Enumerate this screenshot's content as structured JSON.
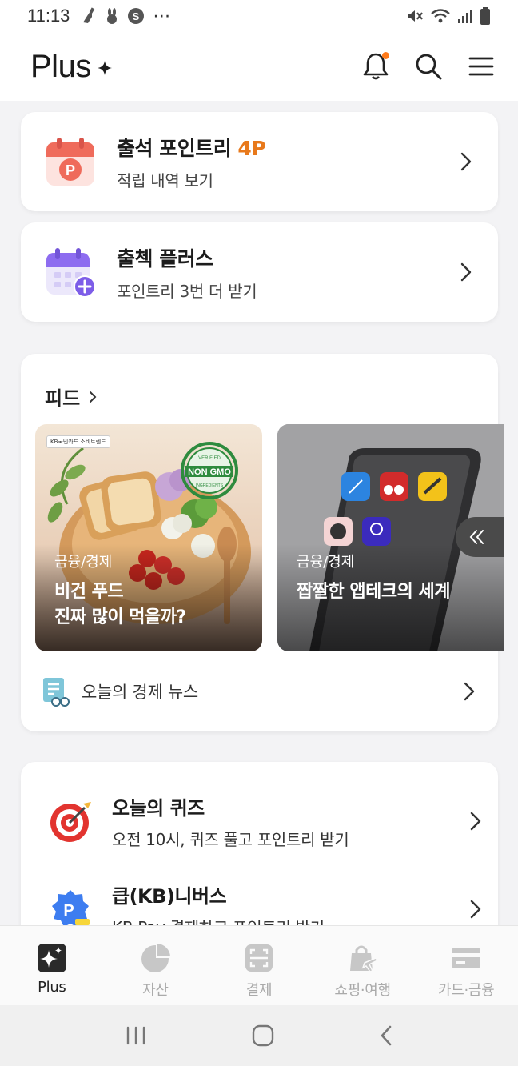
{
  "status": {
    "time": "11:13",
    "dots": "⋯"
  },
  "header": {
    "brand": "Plus"
  },
  "attendance": {
    "title": "출석 포인트리 ",
    "points": "4P",
    "subtitle": "적립 내역 보기"
  },
  "checkplus": {
    "title": "출첵 플러스",
    "subtitle": "포인트리 3번 더 받기"
  },
  "feed": {
    "title": "피드",
    "cards": [
      {
        "category": "금융/경제",
        "title_line1": "비건 푸드",
        "title_line2": "진짜 많이 먹을까?",
        "badge_text": "KB국민카드 소비트렌드",
        "stamp_top": "VERIFIED",
        "stamp_main": "NON GMO",
        "stamp_bottom": "INGREDIENTS"
      },
      {
        "category": "금융/경제",
        "title_line1": "짭짤한 앱테크의 세계"
      }
    ],
    "news_label": "오늘의 경제 뉴스"
  },
  "quiz": {
    "title": "오늘의 퀴즈",
    "subtitle": "오전 10시, 퀴즈 풀고 포인트리 받기"
  },
  "kb": {
    "title": "큽(KB)니버스",
    "subtitle": "KB Pay 결제하고 포인트리 받기"
  },
  "tabs": [
    {
      "label": "Plus",
      "active": true
    },
    {
      "label": "자산",
      "active": false
    },
    {
      "label": "결제",
      "active": false
    },
    {
      "label": "쇼핑·여행",
      "active": false
    },
    {
      "label": "카드·금융",
      "active": false
    }
  ],
  "colors": {
    "accent": "#e8791b",
    "notif": "#ff7a1a",
    "calendar_red": "#ef6b5b",
    "calendar_purple": "#8d6cf0"
  }
}
